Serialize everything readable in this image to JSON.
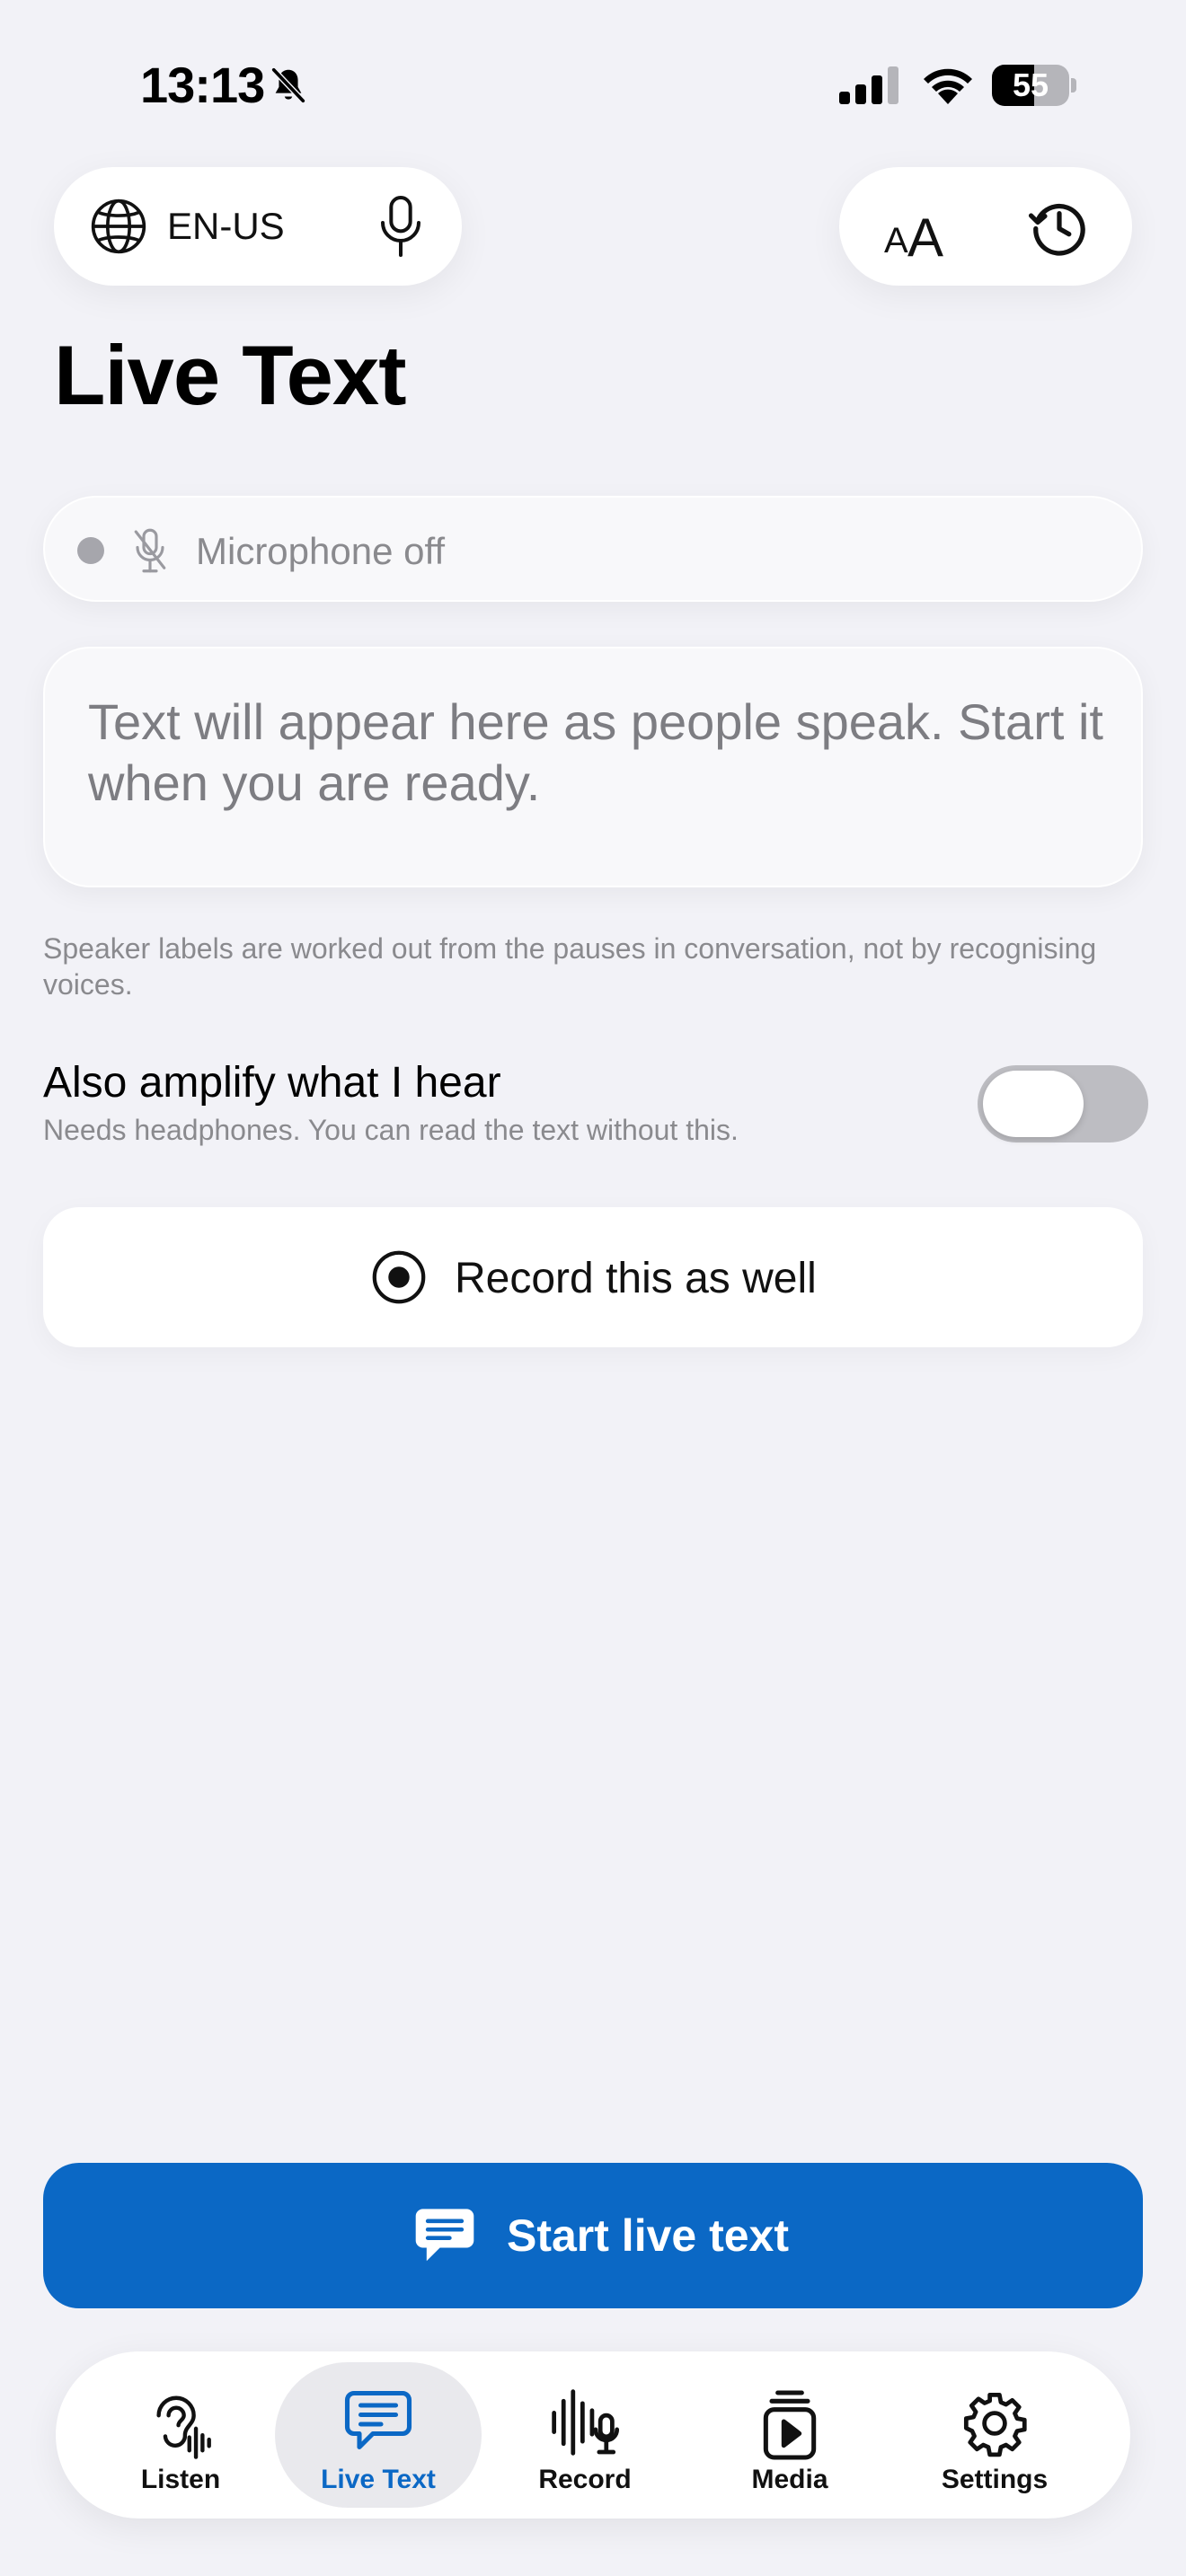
{
  "status_bar": {
    "time": "13:13",
    "battery_percent": 55,
    "battery_label": "55"
  },
  "header": {
    "language": "EN-US"
  },
  "page": {
    "title": "Live Text"
  },
  "mic_status": {
    "text": "Microphone off"
  },
  "transcript": {
    "placeholder": "Text will appear here as people speak. Start it when you are ready."
  },
  "speaker_note": "Speaker labels are worked out from the pauses in conversation, not by recognising voices.",
  "amplify": {
    "title": "Also amplify what I hear",
    "subtitle": "Needs headphones. You can read the text without this.",
    "enabled": false
  },
  "record_button": {
    "label": "Record this as well"
  },
  "start_button": {
    "label": "Start live text"
  },
  "tabs": [
    {
      "label": "Listen",
      "icon": "ear-icon",
      "active": false
    },
    {
      "label": "Live Text",
      "icon": "message-icon",
      "active": true
    },
    {
      "label": "Record",
      "icon": "waveform-mic-icon",
      "active": false
    },
    {
      "label": "Media",
      "icon": "play-stack-icon",
      "active": false
    },
    {
      "label": "Settings",
      "icon": "gear-icon",
      "active": false
    }
  ],
  "colors": {
    "accent": "#0B68C5",
    "background": "#F2F2F7",
    "toggle_off": "#BDBDC2",
    "secondary_text": "#8A8A8E"
  }
}
